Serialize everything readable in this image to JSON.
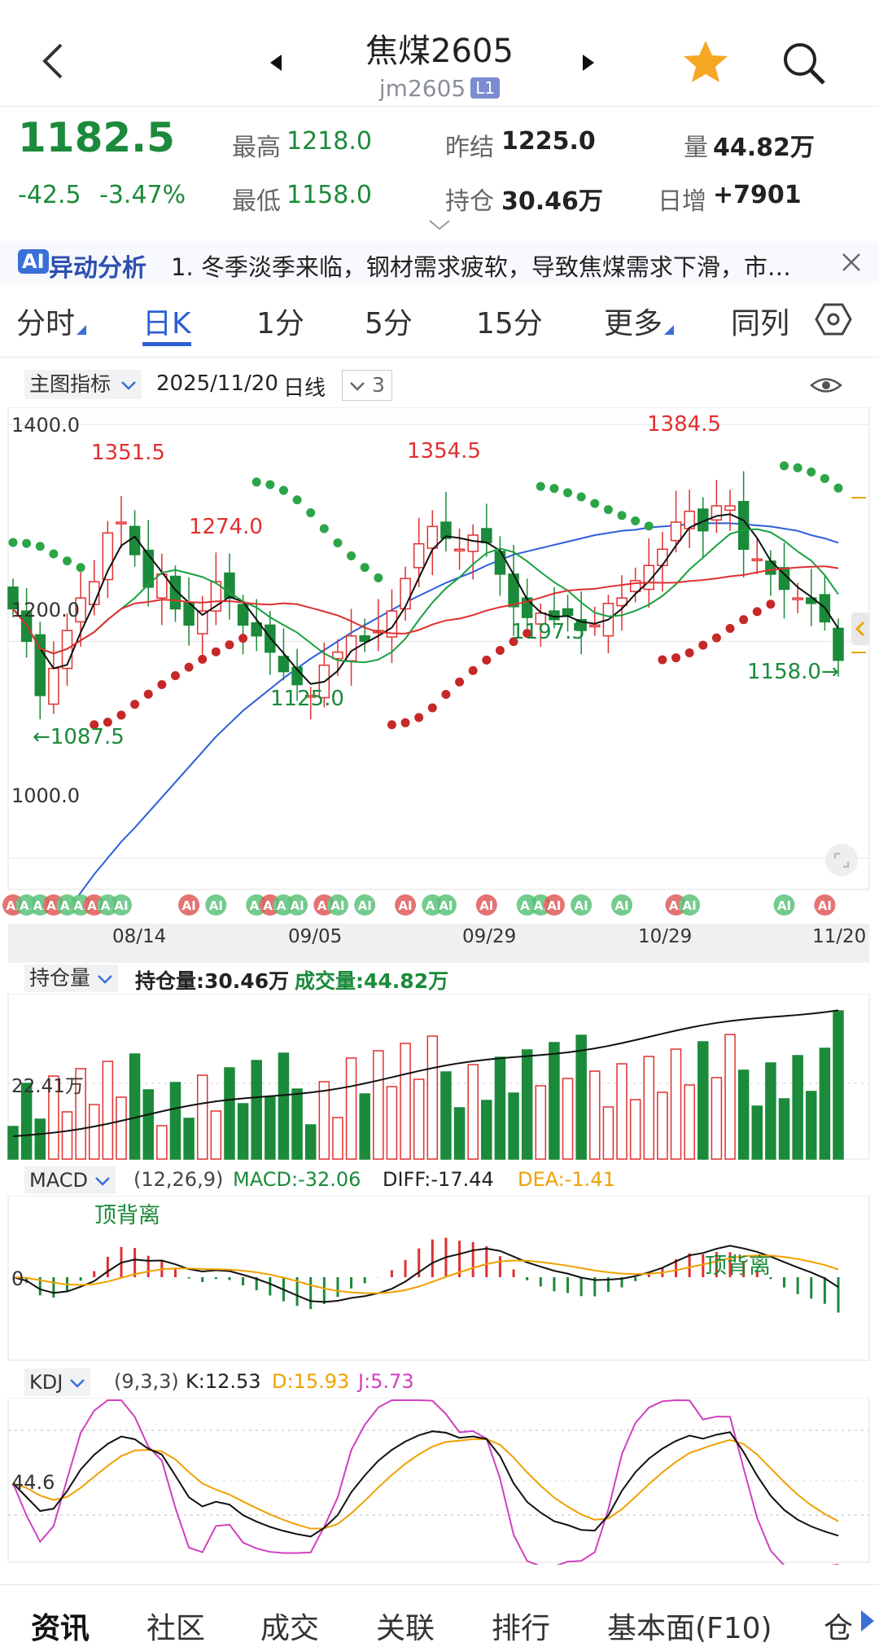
{
  "header": {
    "title": "焦煤2605",
    "code": "jm2605",
    "level_badge": "L1"
  },
  "quote": {
    "price": "1182.5",
    "change": "-42.5",
    "change_pct": "-3.47%",
    "high_label": "最高",
    "high": "1218.0",
    "low_label": "最低",
    "low": "1158.0",
    "prev_settle_label": "昨结",
    "prev_settle": "1225.0",
    "open_interest_label": "持仓",
    "open_interest": "30.46万",
    "volume_label": "量",
    "volume": "44.82万",
    "daily_increase_label": "日增",
    "daily_increase": "+7901"
  },
  "ai_banner": {
    "badge": "AI",
    "title": "异动分析",
    "text": "1. 冬季淡季来临，钢材需求疲软，导致焦煤需求下滑，市…"
  },
  "tabs": [
    "分时",
    "日K",
    "1分",
    "5分",
    "15分",
    "更多",
    "同列"
  ],
  "active_tab": "日K",
  "chart_toolbar": {
    "indicator_select": "主图指标",
    "date": "2025/11/20",
    "period": "日线",
    "count": "3"
  },
  "colors": {
    "up": "#e03030",
    "down": "#1b8a3a",
    "ma_blue": "#2c5fd8",
    "dea_orange": "#f0a000",
    "kdj_j": "#d040c0",
    "accent": "#3a6fd8"
  },
  "chart_data": [
    {
      "type": "candlestick",
      "price_ticks": [
        "1400.0",
        "1200.0",
        "1000.0"
      ],
      "ylim": [
        980,
        1410
      ],
      "x_dates": [
        "08/14",
        "09/05",
        "09/29",
        "10/29",
        "11/20"
      ],
      "annotations": [
        "1351.5",
        "1274.0",
        "1354.5",
        "1384.5",
        "←1087.5",
        "1125.0",
        "1197.5",
        "1158.0→"
      ],
      "closes": [
        1230,
        1200,
        1150,
        1175,
        1210,
        1240,
        1255,
        1300,
        1310,
        1280,
        1250,
        1262,
        1230,
        1215,
        1228,
        1255,
        1240,
        1215,
        1205,
        1190,
        1172,
        1160,
        1150,
        1178,
        1190,
        1205,
        1200,
        1210,
        1228,
        1258,
        1290,
        1306,
        1295,
        1285,
        1298,
        1291,
        1262,
        1232,
        1222,
        1226,
        1220,
        1224,
        1210,
        1215,
        1235,
        1240,
        1256,
        1270,
        1285,
        1310,
        1320,
        1302,
        1325,
        1325,
        1285,
        1276,
        1262,
        1248,
        1240,
        1235,
        1218,
        1182.5
      ],
      "ma_blue": [
        880,
        898,
        918,
        935,
        950,
        968,
        985,
        1000,
        1015,
        1028,
        1042,
        1056,
        1070,
        1084,
        1098,
        1112,
        1124,
        1136,
        1146,
        1156,
        1166,
        1175,
        1184,
        1192,
        1200,
        1208,
        1215,
        1222,
        1229,
        1236,
        1242,
        1248,
        1254,
        1259,
        1264,
        1270,
        1275,
        1280,
        1283,
        1286,
        1289,
        1292,
        1295,
        1298,
        1300,
        1302,
        1303,
        1305,
        1306,
        1307,
        1308,
        1309,
        1309,
        1309,
        1308,
        1307,
        1306,
        1304,
        1302,
        1298,
        1295,
        1291
      ]
    },
    {
      "type": "bar",
      "title": "持仓量",
      "open_interest": "30.46万",
      "volume_label": "成交量",
      "volume": "44.82万",
      "tick": "22.41万"
    },
    {
      "type": "bar",
      "title": "MACD",
      "params": "(12,26,9)",
      "macd": "-32.06",
      "diff": "-17.44",
      "dea": "-1.41",
      "annotations": [
        "顶背离",
        "顶背离"
      ],
      "zero_tick": "0"
    },
    {
      "type": "line",
      "title": "KDJ",
      "params": "(9,3,3)",
      "k": "12.53",
      "d": "15.93",
      "j": "5.73",
      "tick": "44.6"
    }
  ],
  "bottom_nav": [
    "资讯",
    "社区",
    "成交",
    "关联",
    "排行",
    "基本面(F10)",
    "仓"
  ]
}
